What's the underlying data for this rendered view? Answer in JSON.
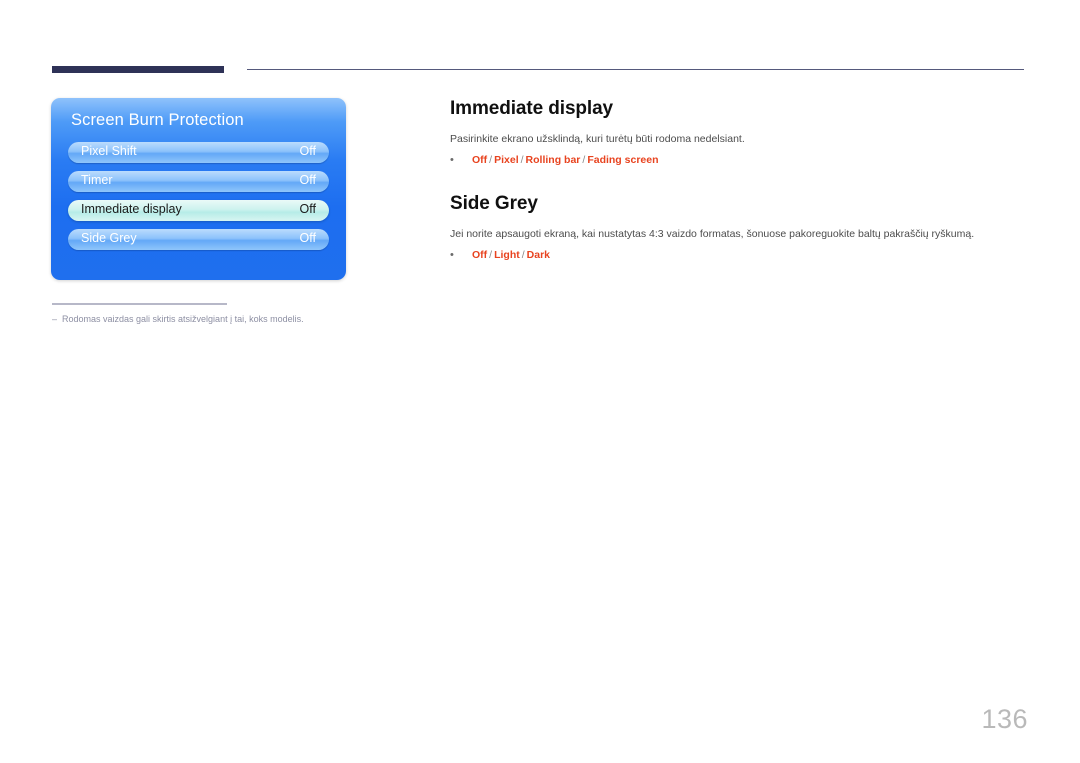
{
  "header": {
    "rule_color": "#2e3257",
    "thin_rule_color": "#55597c"
  },
  "osd": {
    "title": "Screen Burn Protection",
    "rows": [
      {
        "label": "Pixel Shift",
        "value": "Off",
        "selected": false
      },
      {
        "label": "Timer",
        "value": "Off",
        "selected": false
      },
      {
        "label": "Immediate display",
        "value": "Off",
        "selected": true
      },
      {
        "label": "Side Grey",
        "value": "Off",
        "selected": false
      }
    ]
  },
  "footnote": {
    "dash": "–",
    "text": "Rodomas vaizdas gali skirtis atsižvelgiant į tai, koks modelis."
  },
  "content": {
    "sections": [
      {
        "heading": "Immediate display",
        "description": "Pasirinkite ekrano užsklindą, kuri turėtų būti rodoma nedelsiant.",
        "bullet": "•",
        "options": [
          "Off",
          "Pixel",
          "Rolling bar",
          "Fading screen"
        ],
        "separator": "/"
      },
      {
        "heading": "Side Grey",
        "description": "Jei norite apsaugoti ekraną, kai nustatytas 4:3 vaizdo formatas, šonuose pakoreguokite baltų pakraščių ryškumą.",
        "bullet": "•",
        "options": [
          "Off",
          "Light",
          "Dark"
        ],
        "separator": "/"
      }
    ]
  },
  "page_number": "136",
  "colors": {
    "option_red": "#e8431f",
    "panel_blue": "#1f6fee",
    "header_navy": "#2e3257"
  }
}
